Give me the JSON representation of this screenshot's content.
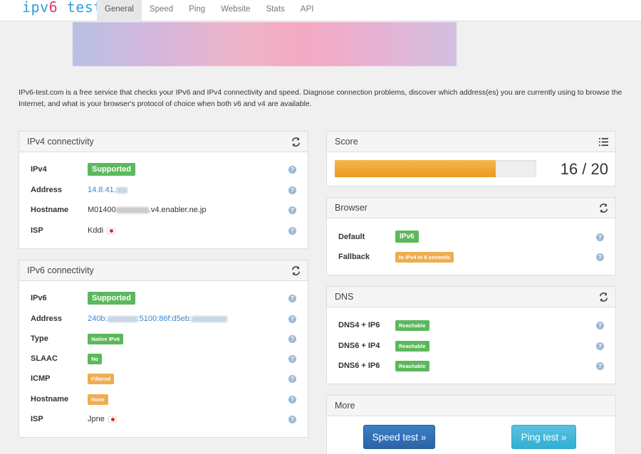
{
  "brand": {
    "part1": "ipv",
    "part2": "6",
    "part3": " test"
  },
  "nav": [
    "General",
    "Speed",
    "Ping",
    "Website",
    "Stats",
    "API"
  ],
  "intro": "IPv6-test.com is a free service that checks your IPv6 and IPv4 connectivity and speed. Diagnose connection problems, discover which address(es) you are currently using to browse the Internet, and what is your browser's protocol of choice when both v6 and v4 are available.",
  "ipv4": {
    "title": "IPv4 connectivity",
    "rows": [
      {
        "label": "IPv4",
        "value": "Supported"
      },
      {
        "label": "Address",
        "value": "14.8.41."
      },
      {
        "label": "Hostname",
        "value_a": "M01400",
        "value_b": ".v4.enabler.ne.jp"
      },
      {
        "label": "ISP",
        "value": "Kddi"
      }
    ]
  },
  "ipv6": {
    "title": "IPv6 connectivity",
    "rows": [
      {
        "label": "IPv6",
        "value": "Supported"
      },
      {
        "label": "Address",
        "value_a": "240b:",
        "value_b": ":5100:86f:d5eb:"
      },
      {
        "label": "Type",
        "value": "Native IPv6"
      },
      {
        "label": "SLAAC",
        "value": "No"
      },
      {
        "label": "ICMP",
        "value": "Filtered"
      },
      {
        "label": "Hostname",
        "value": "None"
      },
      {
        "label": "ISP",
        "value": "Jpne"
      }
    ]
  },
  "score": {
    "title": "Score",
    "text": "16 / 20",
    "value": 16,
    "max": 20
  },
  "browser": {
    "title": "Browser",
    "rows": [
      {
        "label": "Default",
        "value": "IPv6"
      },
      {
        "label": "Fallback",
        "value": "to IPv4 in 8 seconds"
      }
    ]
  },
  "dns": {
    "title": "DNS",
    "rows": [
      {
        "label": "DNS4 + IP6",
        "value": "Reachable"
      },
      {
        "label": "DNS6 + IP4",
        "value": "Reachable"
      },
      {
        "label": "DNS6 + IP6",
        "value": "Reachable"
      }
    ]
  },
  "more": {
    "title": "More",
    "speed_button": "Speed test »",
    "ping_button": "Ping test »"
  },
  "colors": {
    "brand_blue": "#2f9fd6",
    "brand_pink": "#e8376b",
    "success": "#5cb85c",
    "warning": "#f0ad4e",
    "link": "#3a87c8"
  },
  "icons": {
    "refresh": "refresh-icon",
    "list": "list-icon",
    "help": "help-icon",
    "flag": "japan-flag-icon"
  }
}
